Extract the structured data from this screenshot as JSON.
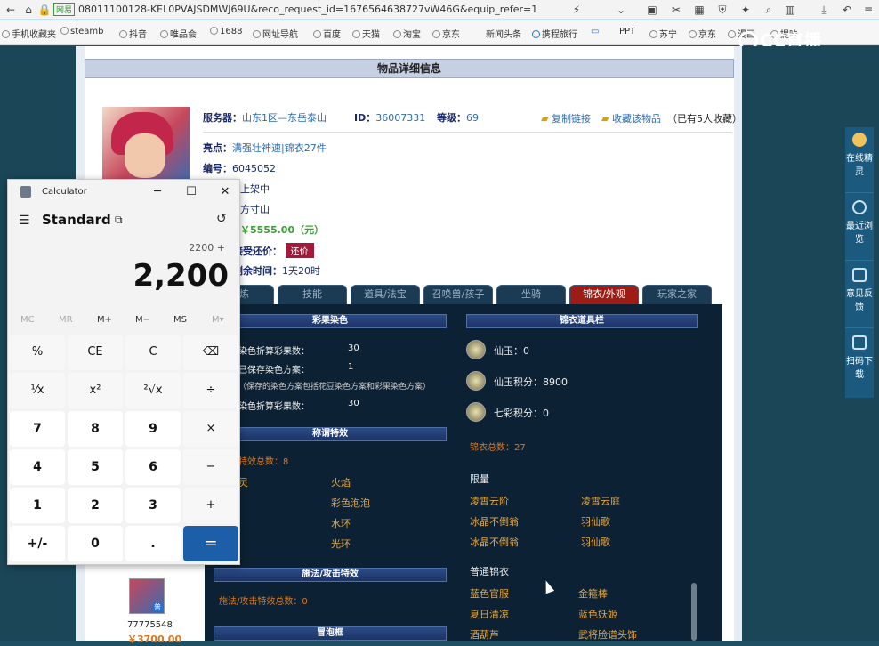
{
  "browser": {
    "url_badge": "网易",
    "url": "08011100128-KEL0PVAJSDMWJ69U&reco_request_id=1676564638727vW46G&equip_refer=1",
    "bookmarks": [
      "手机收藏夹",
      "steamb",
      "抖音",
      "唯品会",
      "1688",
      "网址导航",
      "百度",
      "天猫",
      "淘宝",
      "京东",
      "新闻头条",
      "携程旅行",
      "PPT",
      "苏宁",
      "京东",
      "漫画",
      "提咔"
    ],
    "overlay_logo": "CC直播"
  },
  "page": {
    "title": "物品详细信息",
    "server_label": "服务器：",
    "server_value": "山东1区—东岳泰山",
    "id_label": "ID：",
    "id_value": "36007331",
    "level_label": "等级：",
    "level_value": "69",
    "copy_link": "复制链接",
    "fav_link": "收藏该物品",
    "fav_count": "（已有5人收藏）",
    "highlight_label": "亮点：",
    "highlight_value": "满强壮神速|锦衣27件",
    "number_label": "编号：",
    "number_value": "6045052",
    "status_value": "上架中",
    "school_value": "方寸山",
    "price_value": "￥5555.00（元）",
    "bargain_label": "接受还价：",
    "bargain_button": "还价",
    "time_label": "剩余时间：",
    "time_value": "1天20时"
  },
  "tabs": [
    "修炼",
    "技能",
    "道具/法宝",
    "召唤兽/孩子",
    "坐骑",
    "锦衣/外观",
    "玩家之家"
  ],
  "panel": {
    "color_head": "彩果染色",
    "color_rows": [
      {
        "label": "染色折算彩果数：",
        "value": "30"
      },
      {
        "label": "已保存染色方案：",
        "value": "1"
      },
      {
        "label": "（保存的染色方案包括花豆染色方案和彩果染色方案）",
        "value": ""
      },
      {
        "label": "染色折算彩果数：",
        "value": "30"
      }
    ],
    "title_effect_head": "称谓特效",
    "title_effect_total": "特效总数：8",
    "title_effects": [
      "灵",
      "火焰",
      "彩色泡泡",
      "水环",
      "光环"
    ],
    "cast_head": "施法/攻击特效",
    "cast_total": "施法/攻击特效总数：0",
    "bubble_head": "冒泡框",
    "wardrobe_head": "锦衣道具栏",
    "coins": [
      {
        "label": "仙玉：",
        "value": "0"
      },
      {
        "label": "仙玉积分：",
        "value": "8900"
      },
      {
        "label": "七彩积分：",
        "value": "0"
      }
    ],
    "wardrobe_total": "锦衣总数：27",
    "limited_head": "限量",
    "limited_items": [
      "凌霄云阶",
      "凌霄云庭",
      "冰晶不倒翁",
      "羽仙歌",
      "冰晶不倒翁",
      "羽仙歌"
    ],
    "normal_head": "普通锦衣",
    "normal_items": [
      "蓝色官服",
      "金箍棒",
      "夏日清凉",
      "蓝色妖姬",
      "酒葫芦",
      "武将脸谱头饰"
    ]
  },
  "thumb": {
    "badge": "普",
    "id": "77775548",
    "price": "￥3700.00"
  },
  "sidebar": [
    "在线精灵",
    "最近浏览",
    "意见反馈",
    "扫码下载"
  ],
  "calculator": {
    "title": "Calculator",
    "mode": "Standard",
    "expression": "2200 +",
    "display": "2,200",
    "memory": [
      "MC",
      "MR",
      "M+",
      "M−",
      "MS",
      "M▾"
    ],
    "keys": [
      [
        "%",
        "CE",
        "C",
        "⌫"
      ],
      [
        "¹⁄x",
        "x²",
        "²√x",
        "÷"
      ],
      [
        "7",
        "8",
        "9",
        "×"
      ],
      [
        "4",
        "5",
        "6",
        "−"
      ],
      [
        "1",
        "2",
        "3",
        "+"
      ],
      [
        "+/-",
        "0",
        ".",
        "="
      ]
    ]
  }
}
